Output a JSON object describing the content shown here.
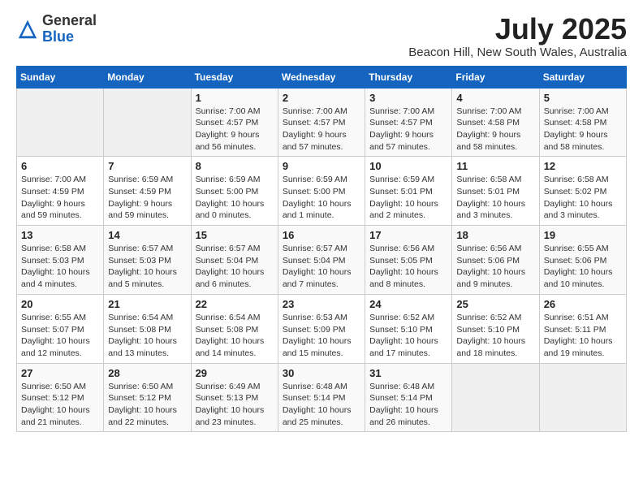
{
  "logo": {
    "general": "General",
    "blue": "Blue"
  },
  "title": "July 2025",
  "subtitle": "Beacon Hill, New South Wales, Australia",
  "days_of_week": [
    "Sunday",
    "Monday",
    "Tuesday",
    "Wednesday",
    "Thursday",
    "Friday",
    "Saturday"
  ],
  "weeks": [
    [
      {
        "day": "",
        "info": ""
      },
      {
        "day": "",
        "info": ""
      },
      {
        "day": "1",
        "info": "Sunrise: 7:00 AM\nSunset: 4:57 PM\nDaylight: 9 hours\nand 56 minutes."
      },
      {
        "day": "2",
        "info": "Sunrise: 7:00 AM\nSunset: 4:57 PM\nDaylight: 9 hours\nand 57 minutes."
      },
      {
        "day": "3",
        "info": "Sunrise: 7:00 AM\nSunset: 4:57 PM\nDaylight: 9 hours\nand 57 minutes."
      },
      {
        "day": "4",
        "info": "Sunrise: 7:00 AM\nSunset: 4:58 PM\nDaylight: 9 hours\nand 58 minutes."
      },
      {
        "day": "5",
        "info": "Sunrise: 7:00 AM\nSunset: 4:58 PM\nDaylight: 9 hours\nand 58 minutes."
      }
    ],
    [
      {
        "day": "6",
        "info": "Sunrise: 7:00 AM\nSunset: 4:59 PM\nDaylight: 9 hours\nand 59 minutes."
      },
      {
        "day": "7",
        "info": "Sunrise: 6:59 AM\nSunset: 4:59 PM\nDaylight: 9 hours\nand 59 minutes."
      },
      {
        "day": "8",
        "info": "Sunrise: 6:59 AM\nSunset: 5:00 PM\nDaylight: 10 hours\nand 0 minutes."
      },
      {
        "day": "9",
        "info": "Sunrise: 6:59 AM\nSunset: 5:00 PM\nDaylight: 10 hours\nand 1 minute."
      },
      {
        "day": "10",
        "info": "Sunrise: 6:59 AM\nSunset: 5:01 PM\nDaylight: 10 hours\nand 2 minutes."
      },
      {
        "day": "11",
        "info": "Sunrise: 6:58 AM\nSunset: 5:01 PM\nDaylight: 10 hours\nand 3 minutes."
      },
      {
        "day": "12",
        "info": "Sunrise: 6:58 AM\nSunset: 5:02 PM\nDaylight: 10 hours\nand 3 minutes."
      }
    ],
    [
      {
        "day": "13",
        "info": "Sunrise: 6:58 AM\nSunset: 5:03 PM\nDaylight: 10 hours\nand 4 minutes."
      },
      {
        "day": "14",
        "info": "Sunrise: 6:57 AM\nSunset: 5:03 PM\nDaylight: 10 hours\nand 5 minutes."
      },
      {
        "day": "15",
        "info": "Sunrise: 6:57 AM\nSunset: 5:04 PM\nDaylight: 10 hours\nand 6 minutes."
      },
      {
        "day": "16",
        "info": "Sunrise: 6:57 AM\nSunset: 5:04 PM\nDaylight: 10 hours\nand 7 minutes."
      },
      {
        "day": "17",
        "info": "Sunrise: 6:56 AM\nSunset: 5:05 PM\nDaylight: 10 hours\nand 8 minutes."
      },
      {
        "day": "18",
        "info": "Sunrise: 6:56 AM\nSunset: 5:06 PM\nDaylight: 10 hours\nand 9 minutes."
      },
      {
        "day": "19",
        "info": "Sunrise: 6:55 AM\nSunset: 5:06 PM\nDaylight: 10 hours\nand 10 minutes."
      }
    ],
    [
      {
        "day": "20",
        "info": "Sunrise: 6:55 AM\nSunset: 5:07 PM\nDaylight: 10 hours\nand 12 minutes."
      },
      {
        "day": "21",
        "info": "Sunrise: 6:54 AM\nSunset: 5:08 PM\nDaylight: 10 hours\nand 13 minutes."
      },
      {
        "day": "22",
        "info": "Sunrise: 6:54 AM\nSunset: 5:08 PM\nDaylight: 10 hours\nand 14 minutes."
      },
      {
        "day": "23",
        "info": "Sunrise: 6:53 AM\nSunset: 5:09 PM\nDaylight: 10 hours\nand 15 minutes."
      },
      {
        "day": "24",
        "info": "Sunrise: 6:52 AM\nSunset: 5:10 PM\nDaylight: 10 hours\nand 17 minutes."
      },
      {
        "day": "25",
        "info": "Sunrise: 6:52 AM\nSunset: 5:10 PM\nDaylight: 10 hours\nand 18 minutes."
      },
      {
        "day": "26",
        "info": "Sunrise: 6:51 AM\nSunset: 5:11 PM\nDaylight: 10 hours\nand 19 minutes."
      }
    ],
    [
      {
        "day": "27",
        "info": "Sunrise: 6:50 AM\nSunset: 5:12 PM\nDaylight: 10 hours\nand 21 minutes."
      },
      {
        "day": "28",
        "info": "Sunrise: 6:50 AM\nSunset: 5:12 PM\nDaylight: 10 hours\nand 22 minutes."
      },
      {
        "day": "29",
        "info": "Sunrise: 6:49 AM\nSunset: 5:13 PM\nDaylight: 10 hours\nand 23 minutes."
      },
      {
        "day": "30",
        "info": "Sunrise: 6:48 AM\nSunset: 5:14 PM\nDaylight: 10 hours\nand 25 minutes."
      },
      {
        "day": "31",
        "info": "Sunrise: 6:48 AM\nSunset: 5:14 PM\nDaylight: 10 hours\nand 26 minutes."
      },
      {
        "day": "",
        "info": ""
      },
      {
        "day": "",
        "info": ""
      }
    ]
  ]
}
